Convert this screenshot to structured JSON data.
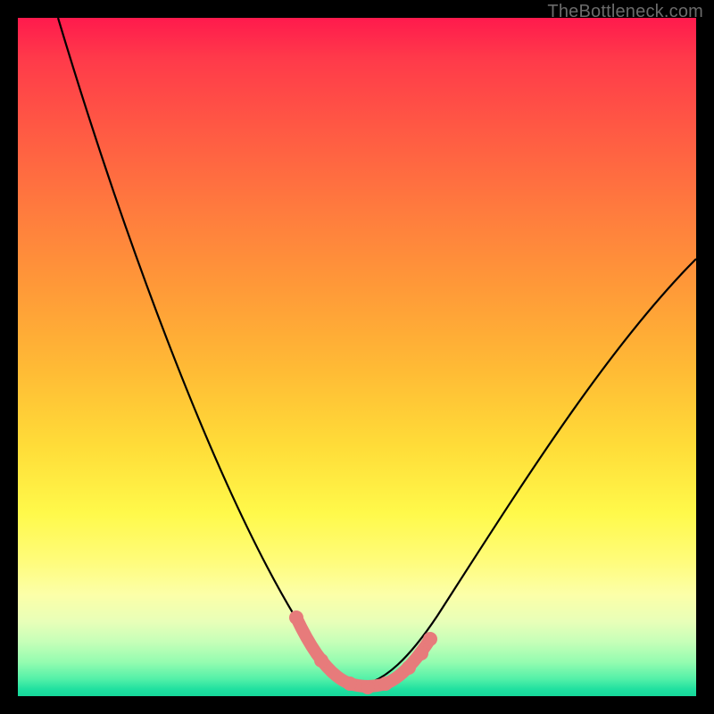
{
  "watermark": {
    "text": "TheBottleneck.com"
  },
  "colors": {
    "background_frame": "#000000",
    "gradient_top": "#ff1a4d",
    "gradient_bottom": "#16d79a",
    "curve": "#000000",
    "marker": "#e77b7b",
    "watermark_text": "#6b6b6b"
  },
  "chart_data": {
    "type": "line",
    "title": "",
    "xlabel": "",
    "ylabel": "",
    "xlim": [
      0,
      100
    ],
    "ylim": [
      0,
      100
    ],
    "grid": false,
    "legend": false,
    "note": "Background is a vertical gradient from red/pink (top ~ high y) through orange and yellow to green (bottom ~ low y). The black curve is a V-shape with its minimum near x≈52, y≈0. Salmon-colored markers highlight points along the bottom of the valley between roughly x=44 and x=60.",
    "series": [
      {
        "name": "bottleneck_curve",
        "x": [
          6,
          10,
          15,
          20,
          25,
          30,
          35,
          40,
          45,
          48,
          50,
          52,
          54,
          56,
          58,
          60,
          65,
          70,
          75,
          80,
          85,
          90,
          95,
          100
        ],
        "y": [
          100,
          89,
          76,
          64,
          53,
          42,
          32,
          22,
          12,
          6,
          2,
          0,
          1,
          2,
          4,
          7,
          13,
          20,
          27,
          34,
          42,
          49,
          57,
          64
        ]
      }
    ],
    "highlight_markers": {
      "name": "valley_markers",
      "x": [
        44,
        47,
        50,
        52,
        54,
        56,
        58,
        60
      ],
      "y": [
        12,
        6,
        2,
        0,
        1,
        2,
        4,
        7
      ]
    }
  }
}
